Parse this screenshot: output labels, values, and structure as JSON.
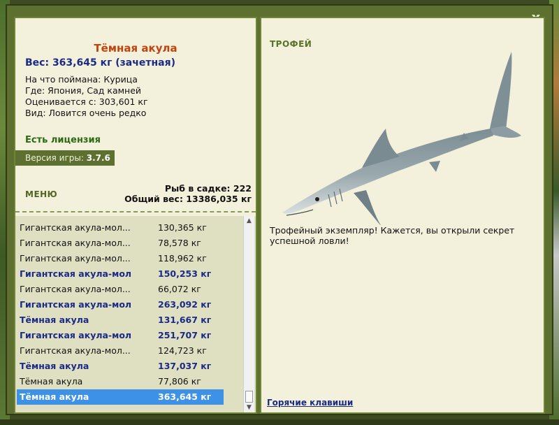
{
  "close_label": "x",
  "fish": {
    "name": "Тёмная акула",
    "weight": "Вес: 363,645 кг (зачетная)",
    "caught_on": "На что поймана: Курица",
    "location": "Где: Япония, Сад камней",
    "price": "Оценивается с: 303,601 кг",
    "rarity": "Вид: Ловится очень редко"
  },
  "license": "Есть лицензия",
  "version": {
    "label": "Версия игры:",
    "value": "3.7.6"
  },
  "menu_label": "МЕНЮ",
  "stats": {
    "fish_in_cage": "Рыб в садке: 222",
    "total_weight": "Общий вес: 13386,035 кг"
  },
  "catch_list": [
    {
      "name": "Гигантская акула-мол...",
      "weight": "130,365 кг",
      "style": "normal"
    },
    {
      "name": "Гигантская акула-мол...",
      "weight": "78,578 кг",
      "style": "normal"
    },
    {
      "name": "Гигантская акула-мол...",
      "weight": "118,962 кг",
      "style": "normal"
    },
    {
      "name": "Гигантская акула-мол",
      "weight": "150,253 кг",
      "style": "bold"
    },
    {
      "name": "Гигантская акула-мол...",
      "weight": "66,072 кг",
      "style": "normal"
    },
    {
      "name": "Гигантская акула-мол",
      "weight": "263,092 кг",
      "style": "bold"
    },
    {
      "name": "Тёмная акула",
      "weight": "131,667 кг",
      "style": "bold"
    },
    {
      "name": "Гигантская акула-мол",
      "weight": "251,707 кг",
      "style": "bold"
    },
    {
      "name": "Гигантская акула-мол...",
      "weight": "124,723 кг",
      "style": "normal"
    },
    {
      "name": "Тёмная акула",
      "weight": "137,037 кг",
      "style": "bold"
    },
    {
      "name": "Тёмная акула",
      "weight": "77,806 кг",
      "style": "normal"
    },
    {
      "name": "Тёмная акула",
      "weight": "363,645 кг",
      "style": "selected"
    }
  ],
  "trophy_title": "ТРОФЕЙ",
  "trophy_text": "Трофейный экземпляр! Кажется, вы открыли секрет успешной ловли!",
  "hotkeys_label": "Горячие клавиши",
  "colors": {
    "frame": "#5d7030",
    "panel": "#f3f1dc",
    "fish_name": "#c0440e",
    "accent_blue": "#1a2a86",
    "selected_row": "#3d92e8"
  }
}
